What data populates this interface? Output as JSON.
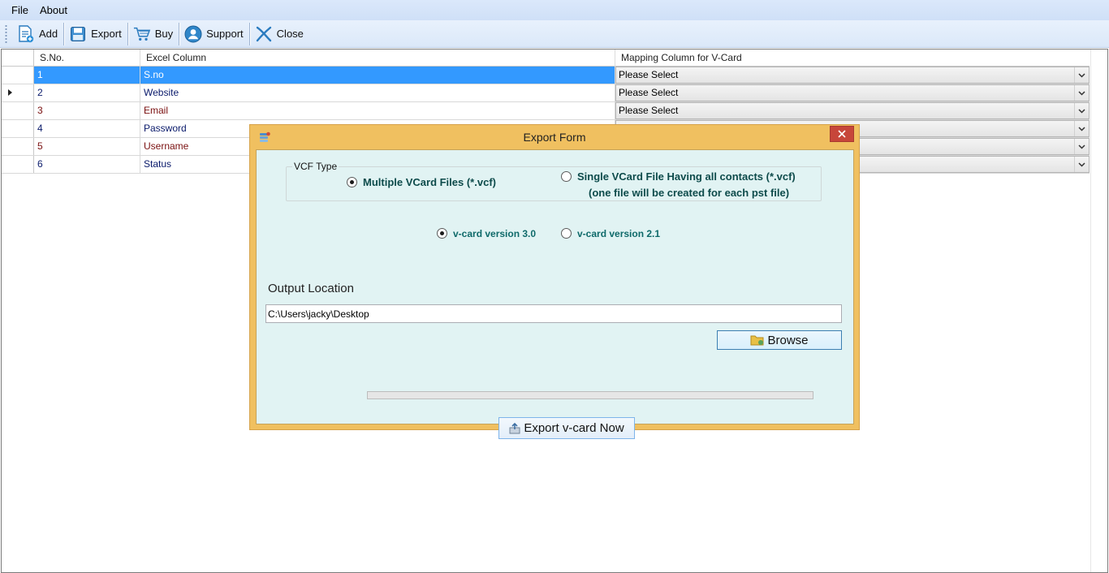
{
  "menu": {
    "file": "File",
    "about": "About"
  },
  "toolbar": {
    "add": "Add",
    "export": "Export",
    "buy": "Buy",
    "support": "Support",
    "close": "Close"
  },
  "grid": {
    "headers": {
      "sno": "S.No.",
      "excel": "Excel Column",
      "mapping": "Mapping Column for V-Card"
    },
    "rows": [
      {
        "sno": "1",
        "excel": "S.no",
        "mapping": "Please Select"
      },
      {
        "sno": "2",
        "excel": "Website",
        "mapping": "Please Select"
      },
      {
        "sno": "3",
        "excel": "Email",
        "mapping": "Please Select"
      },
      {
        "sno": "4",
        "excel": "Password",
        "mapping": ""
      },
      {
        "sno": "5",
        "excel": "Username",
        "mapping": ""
      },
      {
        "sno": "6",
        "excel": "Status",
        "mapping": ""
      }
    ]
  },
  "dialog": {
    "title": "Export Form",
    "vcf_type_legend": "VCF Type",
    "multiple_label": "Multiple VCard Files (*.vcf)",
    "single_label": "Single VCard File Having all contacts (*.vcf)",
    "single_sub_label": "(one file will be created for each pst file)",
    "version30_label": "v-card version 3.0",
    "version21_label": "v-card version 2.1",
    "output_label": "Output Location",
    "output_path": "C:\\Users\\jacky\\Desktop",
    "browse_label": "Browse",
    "export_label": "Export v-card Now",
    "progress_fraction": 0
  }
}
